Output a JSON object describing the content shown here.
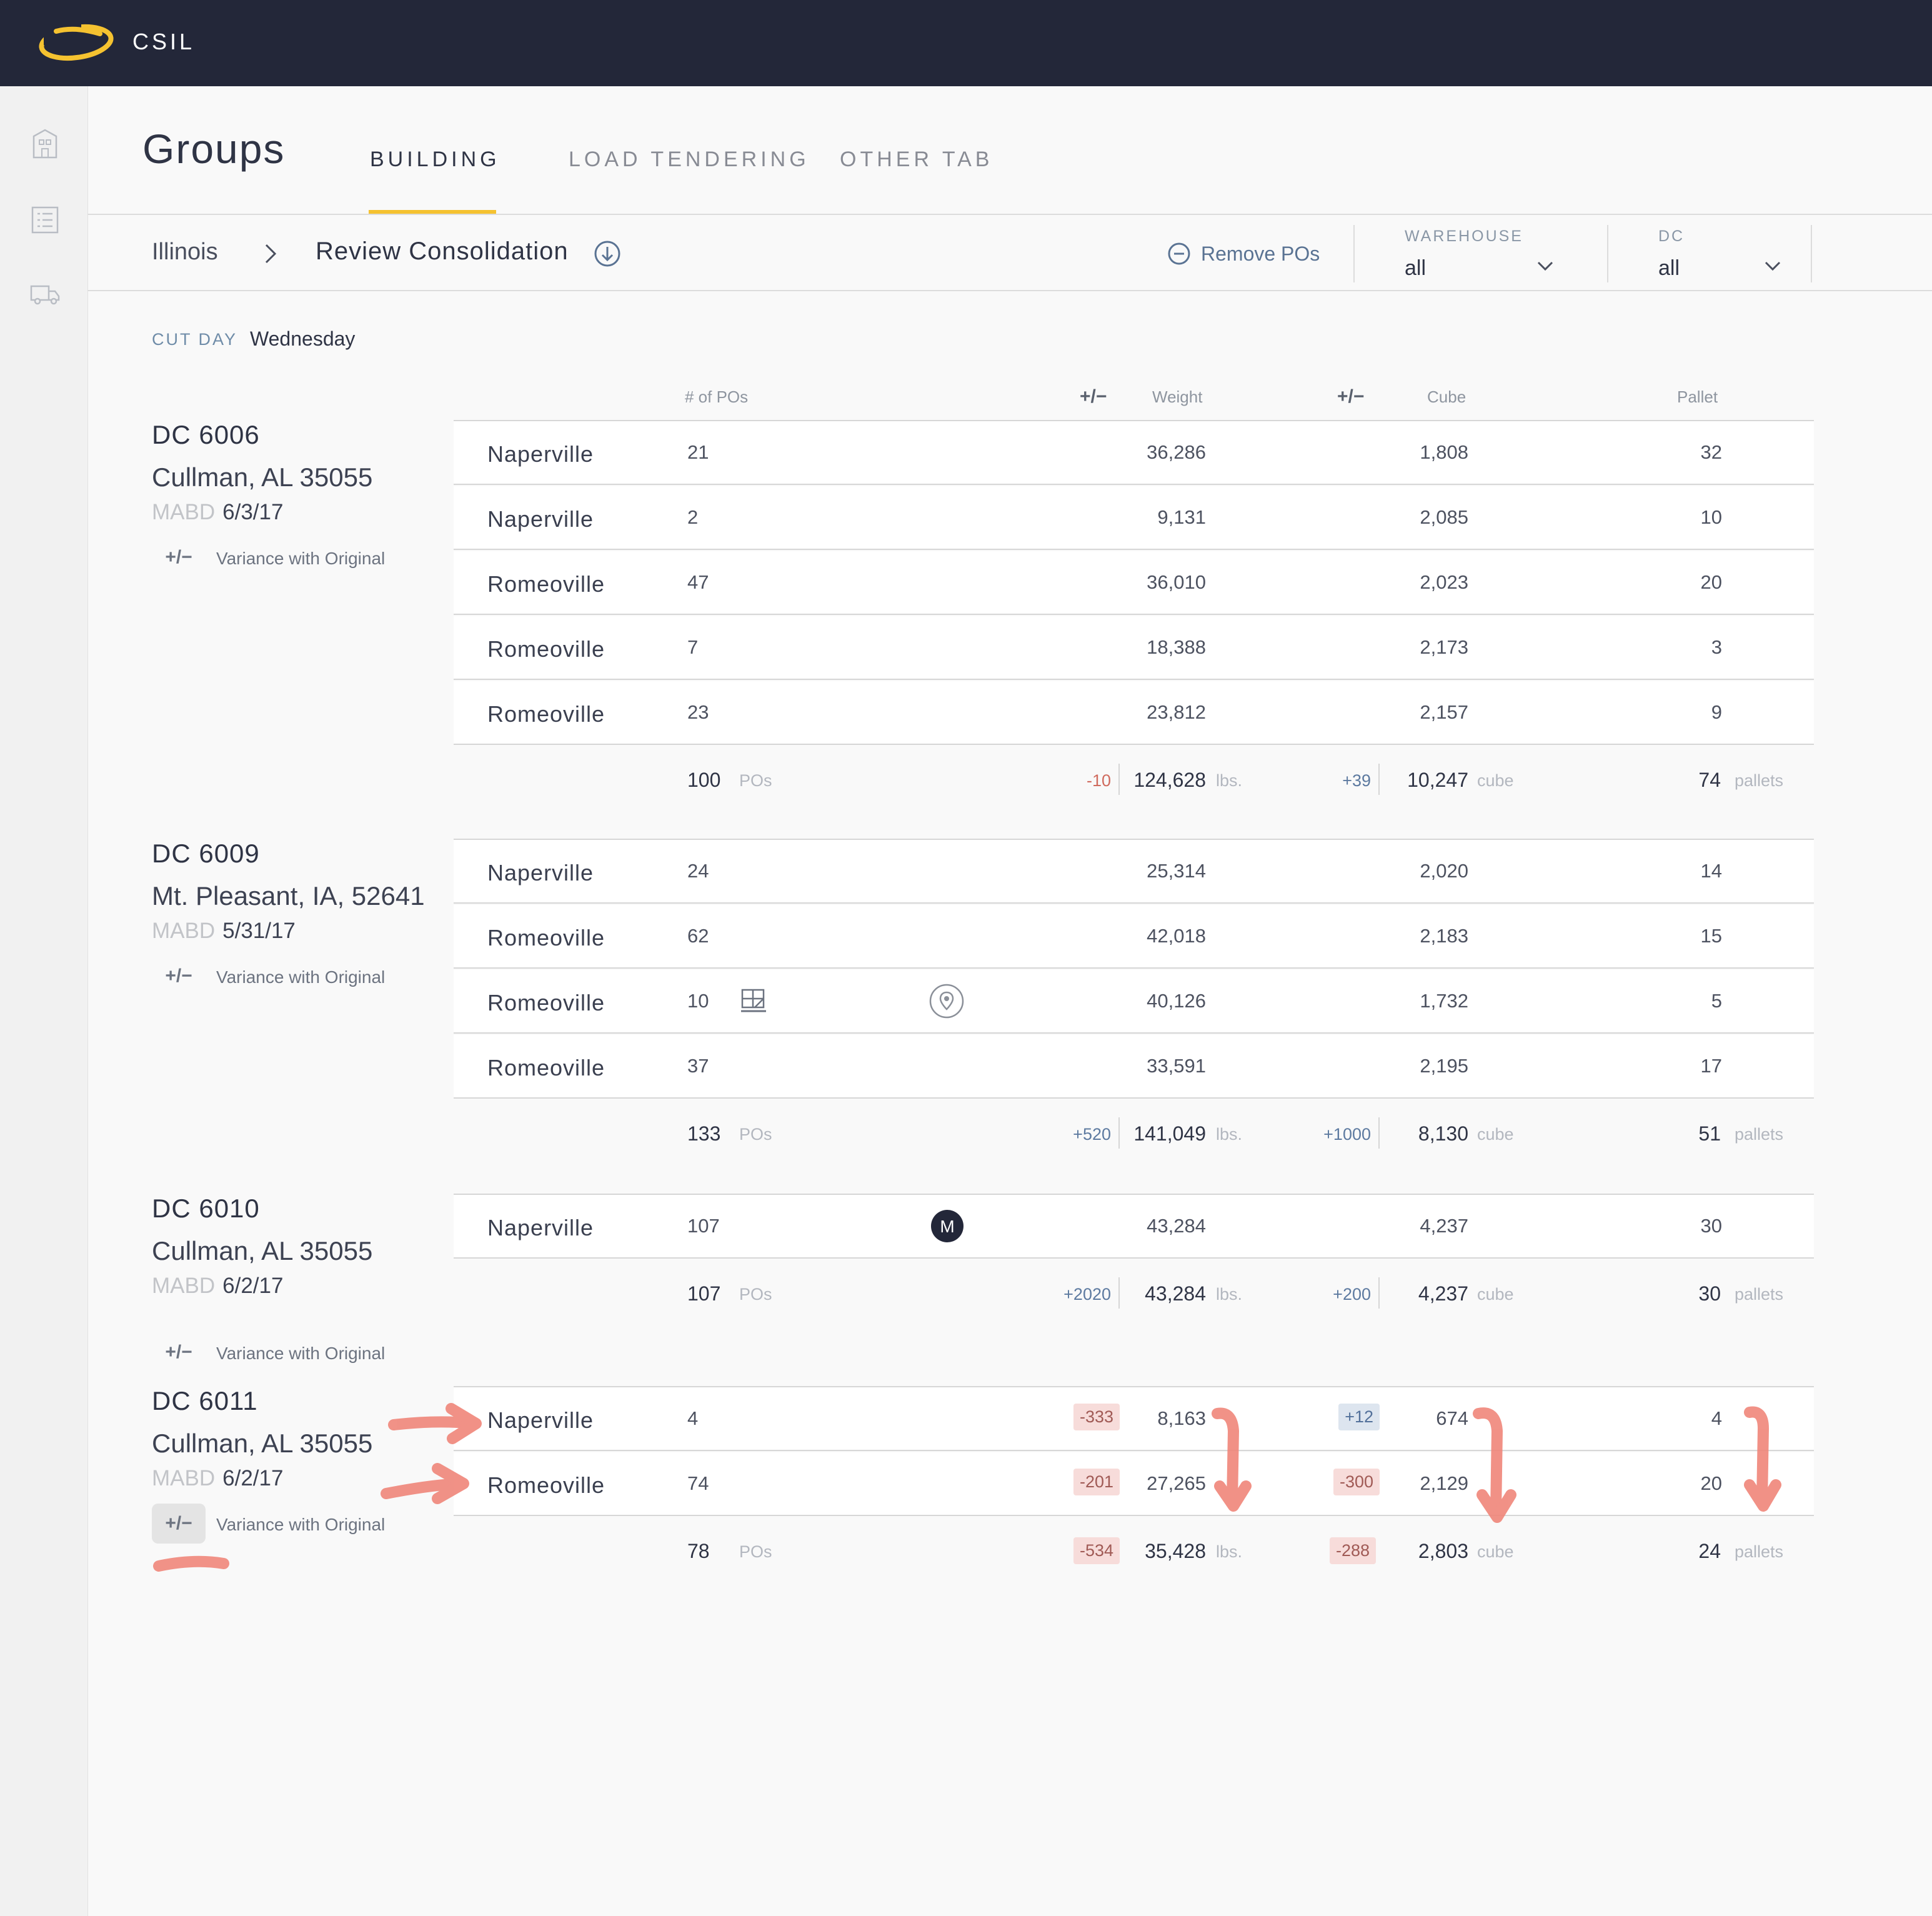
{
  "app": {
    "name": "CSIL"
  },
  "page": {
    "title": "Groups"
  },
  "tabs": [
    {
      "label": "BUILDING",
      "active": true
    },
    {
      "label": "LOAD TENDERING",
      "active": false
    },
    {
      "label": "OTHER TAB",
      "active": false
    }
  ],
  "breadcrumb": {
    "state": "Illinois",
    "page": "Review Consolidation"
  },
  "actions": {
    "remove_pos": "Remove POs"
  },
  "filters": {
    "warehouse": {
      "label": "WAREHOUSE",
      "value": "all"
    },
    "dc": {
      "label": "DC",
      "value": "all"
    }
  },
  "cut_day": {
    "label": "CUT DAY",
    "value": "Wednesday"
  },
  "columns": {
    "pos": "# of POs",
    "weight_var": "+/−",
    "weight": "Weight",
    "cube_var": "+/−",
    "cube": "Cube",
    "pallet": "Pallet"
  },
  "variance_btn": "+/−",
  "variance_label": "Variance with Original",
  "mabd_label": "MABD",
  "units": {
    "pos": "POs",
    "weight": "lbs.",
    "cube": "cube",
    "pallet": "pallets"
  },
  "icons": {
    "sidebar": [
      "building-icon",
      "list-icon",
      "truck-icon"
    ],
    "row_icons": [
      "pallet-icon",
      "location-pin-icon",
      "m-badge-icon"
    ]
  },
  "colors": {
    "accent": "#f5c230",
    "topbar": "#232739",
    "annotation": "#f0867a",
    "link": "#5a7393"
  },
  "groups": [
    {
      "dc": "DC 6006",
      "address": "Cullman, AL 35055",
      "mabd": "6/3/17",
      "variance_active": false,
      "rows": [
        {
          "warehouse": "Naperville",
          "pos": "21",
          "weight": "36,286",
          "cube": "1,808",
          "pallet": "32"
        },
        {
          "warehouse": "Naperville",
          "pos": "2",
          "weight": "9,131",
          "cube": "2,085",
          "pallet": "10"
        },
        {
          "warehouse": "Romeoville",
          "pos": "47",
          "weight": "36,010",
          "cube": "2,023",
          "pallet": "20"
        },
        {
          "warehouse": "Romeoville",
          "pos": "7",
          "weight": "18,388",
          "cube": "2,173",
          "pallet": "3"
        },
        {
          "warehouse": "Romeoville",
          "pos": "23",
          "weight": "23,812",
          "cube": "2,157",
          "pallet": "9"
        }
      ],
      "totals": {
        "pos": "100",
        "weight_var": "-10",
        "weight": "124,628",
        "cube_var": "+39",
        "cube": "10,247",
        "pallet": "74"
      }
    },
    {
      "dc": "DC 6009",
      "address": "Mt. Pleasant, IA, 52641",
      "mabd": "5/31/17",
      "variance_active": false,
      "rows": [
        {
          "warehouse": "Naperville",
          "pos": "24",
          "weight": "25,314",
          "cube": "2,020",
          "pallet": "14"
        },
        {
          "warehouse": "Romeoville",
          "pos": "62",
          "weight": "42,018",
          "cube": "2,183",
          "pallet": "15"
        },
        {
          "warehouse": "Romeoville",
          "pos": "10",
          "weight": "40,126",
          "cube": "1,732",
          "pallet": "5"
        },
        {
          "warehouse": "Romeoville",
          "pos": "37",
          "weight": "33,591",
          "cube": "2,195",
          "pallet": "17"
        }
      ],
      "totals": {
        "pos": "133",
        "weight_var": "+520",
        "weight": "141,049",
        "cube_var": "+1000",
        "cube": "8,130",
        "pallet": "51"
      }
    },
    {
      "dc": "DC 6010",
      "address": "Cullman, AL 35055",
      "mabd": "6/2/17",
      "variance_active": false,
      "rows": [
        {
          "warehouse": "Naperville",
          "pos": "107",
          "weight": "43,284",
          "cube": "4,237",
          "pallet": "30",
          "badge": "M"
        }
      ],
      "totals": {
        "pos": "107",
        "weight_var": "+2020",
        "weight": "43,284",
        "cube_var": "+200",
        "cube": "4,237",
        "pallet": "30"
      }
    },
    {
      "dc": "DC 6011",
      "address": "Cullman, AL 35055",
      "mabd": "6/2/17",
      "variance_active": true,
      "rows": [
        {
          "warehouse": "Naperville",
          "pos": "4",
          "weight_var": "-333",
          "weight": "8,163",
          "cube_var": "+12",
          "cube": "674",
          "pallet": "4"
        },
        {
          "warehouse": "Romeoville",
          "pos": "74",
          "weight_var": "-201",
          "weight": "27,265",
          "cube_var": "-300",
          "cube": "2,129",
          "pallet": "20"
        }
      ],
      "totals": {
        "pos": "78",
        "weight_var": "-534",
        "weight": "35,428",
        "cube_var": "-288",
        "cube": "2,803",
        "pallet": "24"
      }
    }
  ]
}
